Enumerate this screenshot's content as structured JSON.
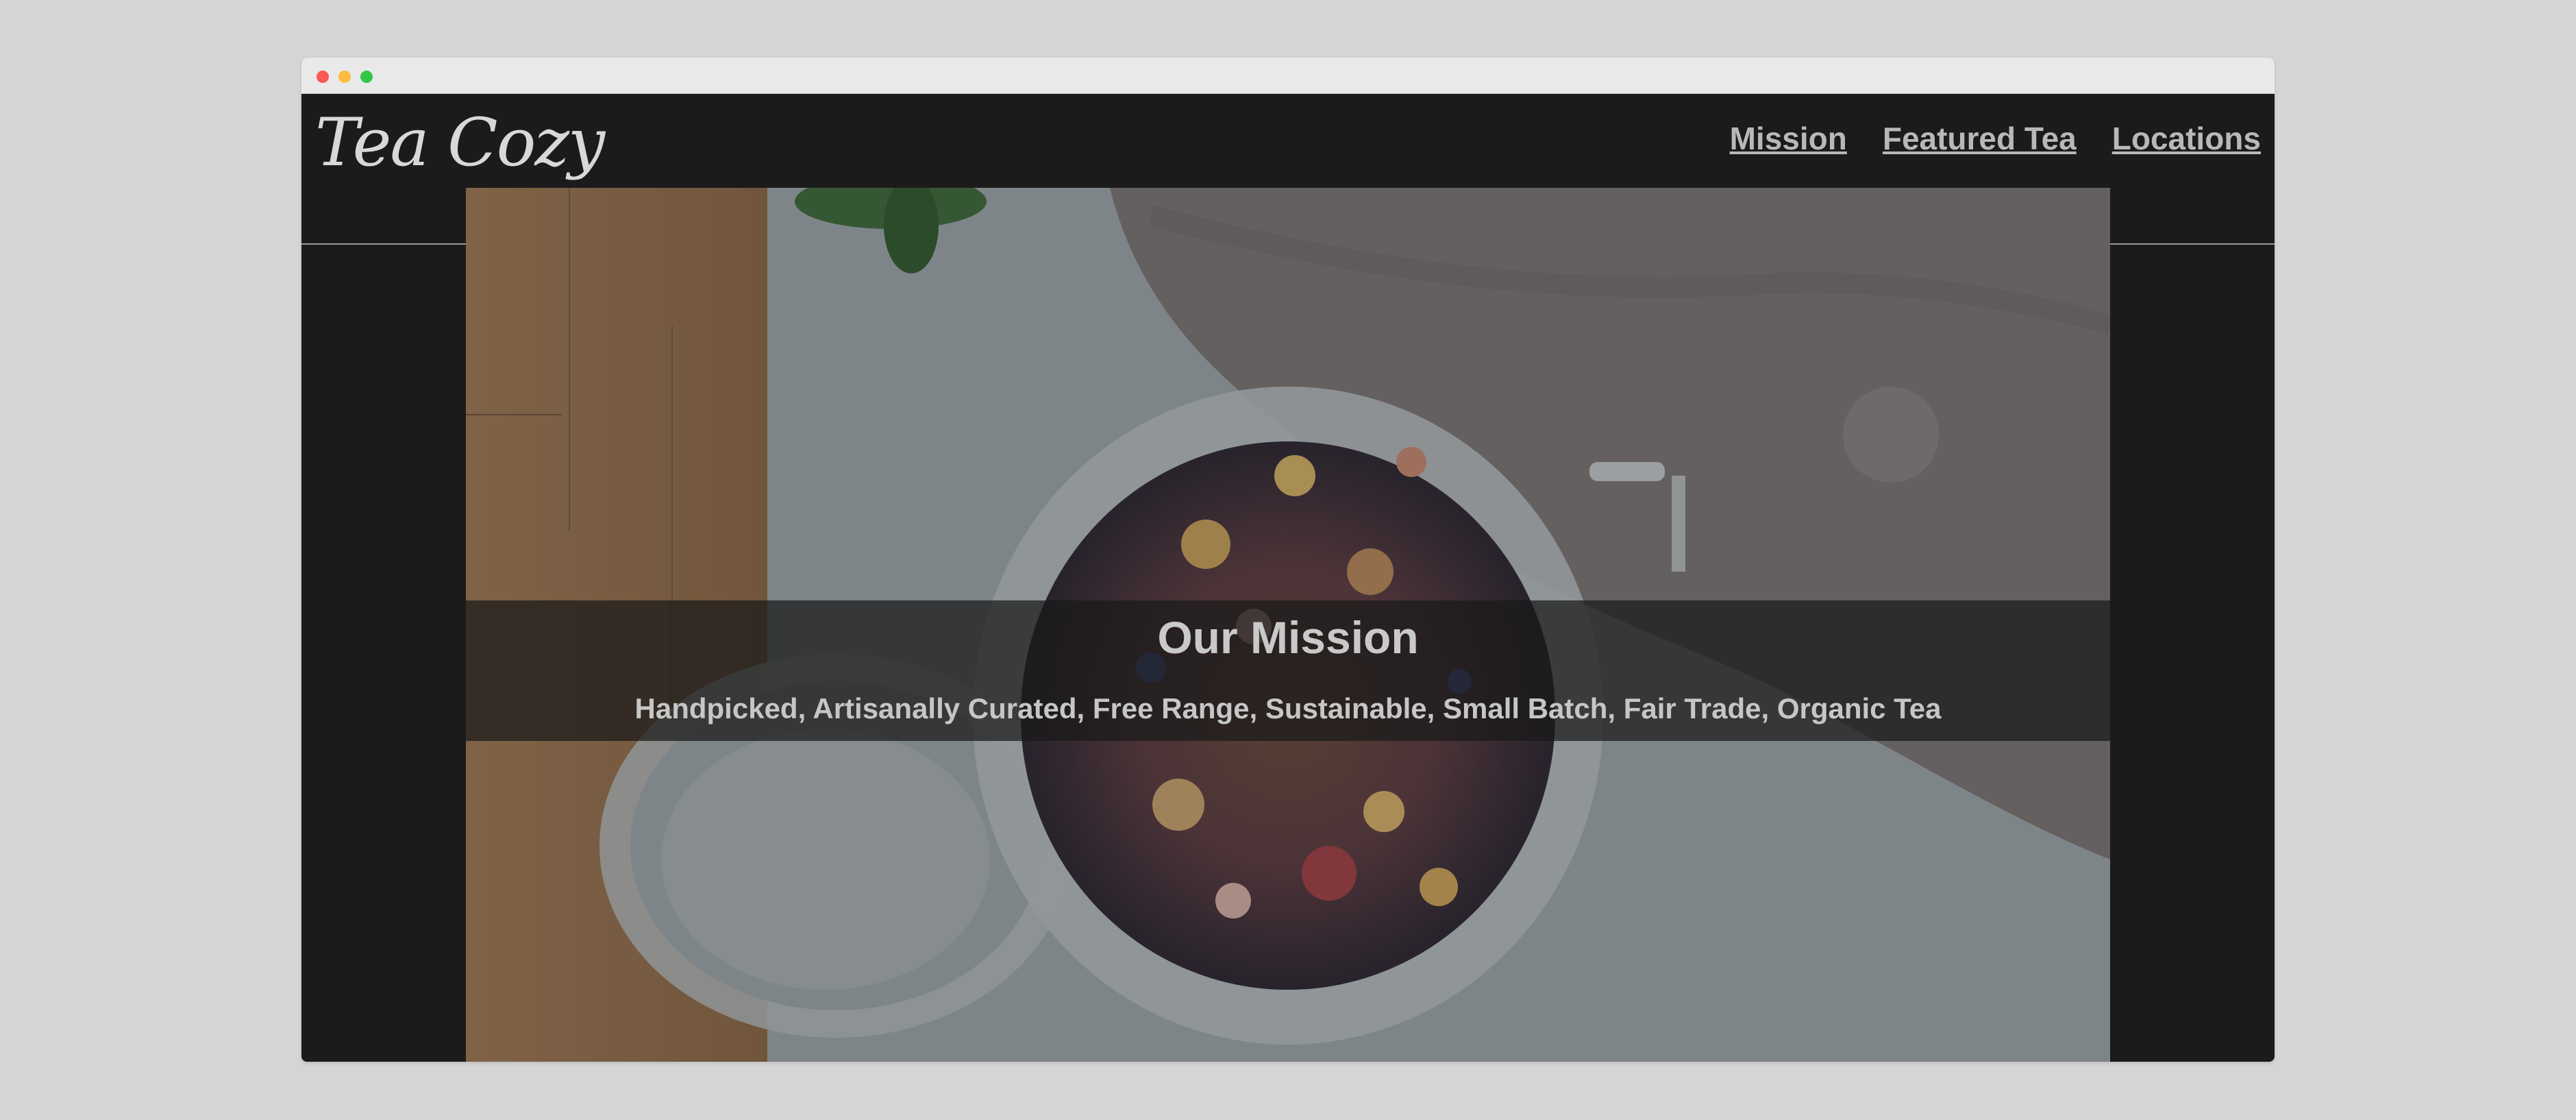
{
  "window": {
    "controls": [
      "close",
      "minimize",
      "maximize"
    ]
  },
  "navbar": {
    "logo": "Tea Cozy",
    "links": [
      "Mission",
      "Featured Tea",
      "Locations"
    ]
  },
  "hero": {
    "image_icon": "loose-leaf-tea-jar-photo",
    "title": "Our Mission",
    "subtitle": "Handpicked, Artisanally Curated, Free Range, Sustainable, Small Batch, Fair Trade, Organic Tea"
  },
  "colors": {
    "page_background": "#d5d5d5",
    "site_background": "#1b1b1b",
    "nav_text": "#b8b8b8",
    "band_background": "rgba(25,25,25,0.72)"
  }
}
